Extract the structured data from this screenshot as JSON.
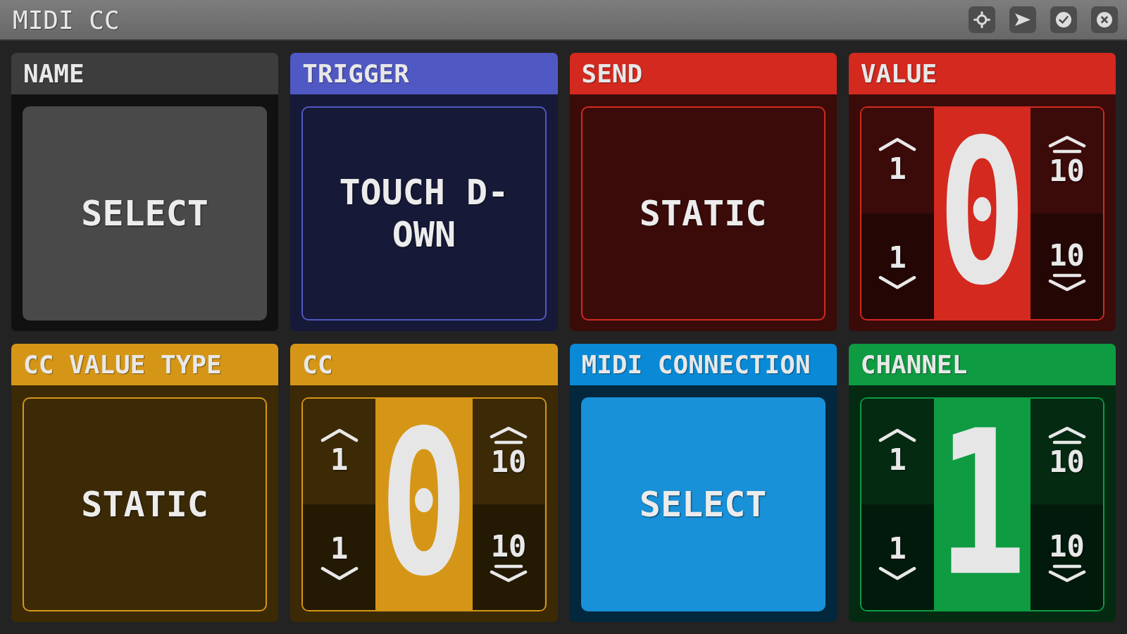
{
  "window": {
    "title": "MIDI CC"
  },
  "cards": [
    {
      "title": "NAME",
      "color": "#3d3d3d",
      "kind": "filled",
      "value": "SELECT"
    },
    {
      "title": "TRIGGER",
      "color": "#5058c4",
      "kind": "outline",
      "value": "TOUCH D-OWN"
    },
    {
      "title": "SEND",
      "color": "#d4291f",
      "kind": "outline",
      "value": "STATIC"
    },
    {
      "title": "VALUE",
      "color": "#d4291f",
      "kind": "stepper",
      "value": "0",
      "left_steps": [
        {
          "kind": "up",
          "label": "1"
        },
        {
          "kind": "down",
          "label": "1"
        }
      ],
      "right_steps": [
        {
          "kind": "up",
          "label": "10"
        },
        {
          "kind": "down",
          "label": "10"
        }
      ]
    },
    {
      "title": "CC VALUE TYPE",
      "color": "#d59617",
      "kind": "outline",
      "value": "STATIC"
    },
    {
      "title": "CC",
      "color": "#d59617",
      "kind": "stepper",
      "value": "0",
      "left_steps": [
        {
          "kind": "up",
          "label": "1"
        },
        {
          "kind": "down",
          "label": "1"
        }
      ],
      "right_steps": [
        {
          "kind": "up",
          "label": "10"
        },
        {
          "kind": "down",
          "label": "10"
        }
      ]
    },
    {
      "title": "MIDI CONNECTION",
      "color": "#0a8ad6",
      "kind": "filled",
      "value": "SELECT"
    },
    {
      "title": "CHANNEL",
      "color": "#0e9b42",
      "kind": "stepper",
      "value": "1",
      "left_steps": [
        {
          "kind": "up",
          "label": "1"
        },
        {
          "kind": "down",
          "label": "1"
        }
      ],
      "right_steps": [
        {
          "kind": "up",
          "label": "10"
        },
        {
          "kind": "down",
          "label": "10"
        }
      ]
    }
  ]
}
